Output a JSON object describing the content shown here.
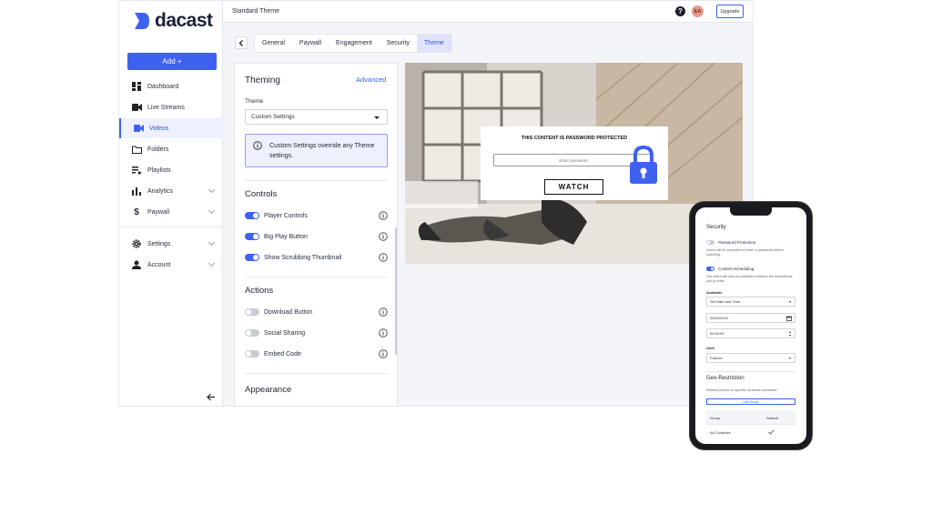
{
  "brand": {
    "name": "dacast",
    "accent": "#3f61f0"
  },
  "sidebar": {
    "add_label": "Add +",
    "items": [
      {
        "label": "Dashboard",
        "icon": "dashboard-icon"
      },
      {
        "label": "Live Streams",
        "icon": "camera-icon"
      },
      {
        "label": "Videos",
        "icon": "video-icon",
        "active": true
      },
      {
        "label": "Folders",
        "icon": "folder-icon"
      },
      {
        "label": "Playlists",
        "icon": "playlist-icon"
      },
      {
        "label": "Analytics",
        "icon": "bar-chart-icon"
      },
      {
        "label": "Paywall",
        "icon": "dollar-icon"
      },
      {
        "label": "Settings",
        "icon": "gear-icon"
      },
      {
        "label": "Account",
        "icon": "person-icon"
      }
    ],
    "collapse_icon": "arrow-left-icon"
  },
  "header": {
    "title": "Standard Theme",
    "avatar_initials": "EA",
    "upgrade_label": "Upgrade"
  },
  "tabs": [
    "General",
    "Paywall",
    "Engagement",
    "Security",
    "Theme"
  ],
  "active_tab": "Theme",
  "theming": {
    "title": "Theming",
    "advanced_label": "Advanced",
    "theme_label": "Theme",
    "theme_value": "Custom Settings",
    "info_text": "Custom Settings override any Theme settings.",
    "controls_title": "Controls",
    "controls": [
      {
        "label": "Player Controls",
        "on": true
      },
      {
        "label": "Big Play Button",
        "on": true
      },
      {
        "label": "Show Scrubbing Thumbnail",
        "on": true
      }
    ],
    "actions_title": "Actions",
    "actions": [
      {
        "label": "Download Button",
        "on": false
      },
      {
        "label": "Social Sharing",
        "on": false
      },
      {
        "label": "Embed Code",
        "on": false
      }
    ],
    "appearance_title": "Appearance"
  },
  "preview": {
    "protected_text": "THIS CONTENT IS PASSWORD PROTECTED",
    "password_placeholder": "Enter password",
    "watch_label": "WATCH"
  },
  "mobile": {
    "security_title": "Security",
    "password_protection_label": "Password Protection",
    "password_protection_desc": "Users will be prompted to enter a password before watching.",
    "content_scheduling_label": "Content Scheduling",
    "content_scheduling_desc": "The video will only be available between the dates/times you provide",
    "available_label": "Available",
    "available_value": "Set Date and Time",
    "date_value": "05/02/2019",
    "time_value": "00:00:00",
    "until_label": "Until",
    "until_value": "Forever",
    "geo_title": "Geo-Restriction",
    "geo_desc": "Restrict access to specific locations worldwide.",
    "add_group_label": "Add Group",
    "table_headers": [
      "Group",
      "Default"
    ],
    "table_rows": [
      {
        "group": "All Countries",
        "default": true
      }
    ]
  }
}
